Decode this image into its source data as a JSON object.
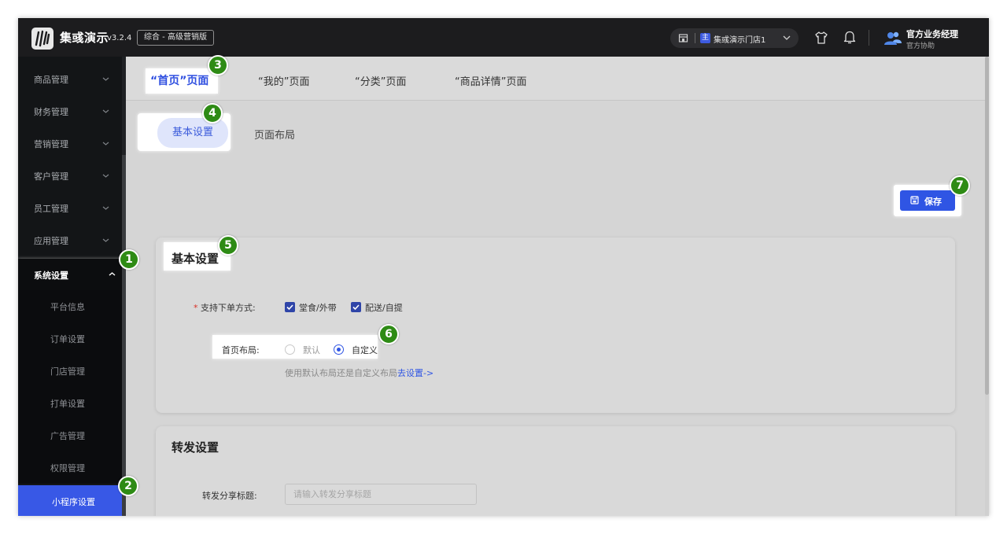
{
  "app": {
    "name": "集彧演示",
    "version": "v3.2.4",
    "edition": "综合 - 高级营销版"
  },
  "header": {
    "store_tag": "主",
    "store_name": "集彧演示门店1",
    "user_name": "官方业务经理",
    "user_role": "官方协助"
  },
  "sidebar": {
    "items": [
      {
        "label": "商品管理"
      },
      {
        "label": "财务管理"
      },
      {
        "label": "营销管理"
      },
      {
        "label": "客户管理"
      },
      {
        "label": "员工管理"
      },
      {
        "label": "应用管理"
      },
      {
        "label": "系统设置"
      }
    ],
    "sub_items": [
      {
        "label": "平台信息"
      },
      {
        "label": "订单设置"
      },
      {
        "label": "门店管理"
      },
      {
        "label": "打单设置"
      },
      {
        "label": "广告管理"
      },
      {
        "label": "权限管理"
      },
      {
        "label": "小程序设置"
      }
    ]
  },
  "page_tabs": [
    "“首页”页面",
    "“我的”页面",
    "“分类”页面",
    "“商品详情”页面"
  ],
  "sub_tabs": [
    "基本设置",
    "页面布局"
  ],
  "save_label": "保存",
  "basic_card": {
    "title": "基本设置",
    "order_label": "支持下单方式:",
    "order_options": [
      "堂食/外带",
      "配送/自提"
    ],
    "layout_label": "首页布局:",
    "layout_options": [
      "默认",
      "自定义"
    ],
    "layout_selected": "自定义",
    "hint_text": "使用默认布局还是自定义布局",
    "hint_link": "去设置->"
  },
  "share_card": {
    "title": "转发设置",
    "share_title_label": "转发分享标题:",
    "share_title_placeholder": "请输入转发分享标题"
  },
  "markers": [
    "1",
    "2",
    "3",
    "4",
    "5",
    "6",
    "7"
  ]
}
